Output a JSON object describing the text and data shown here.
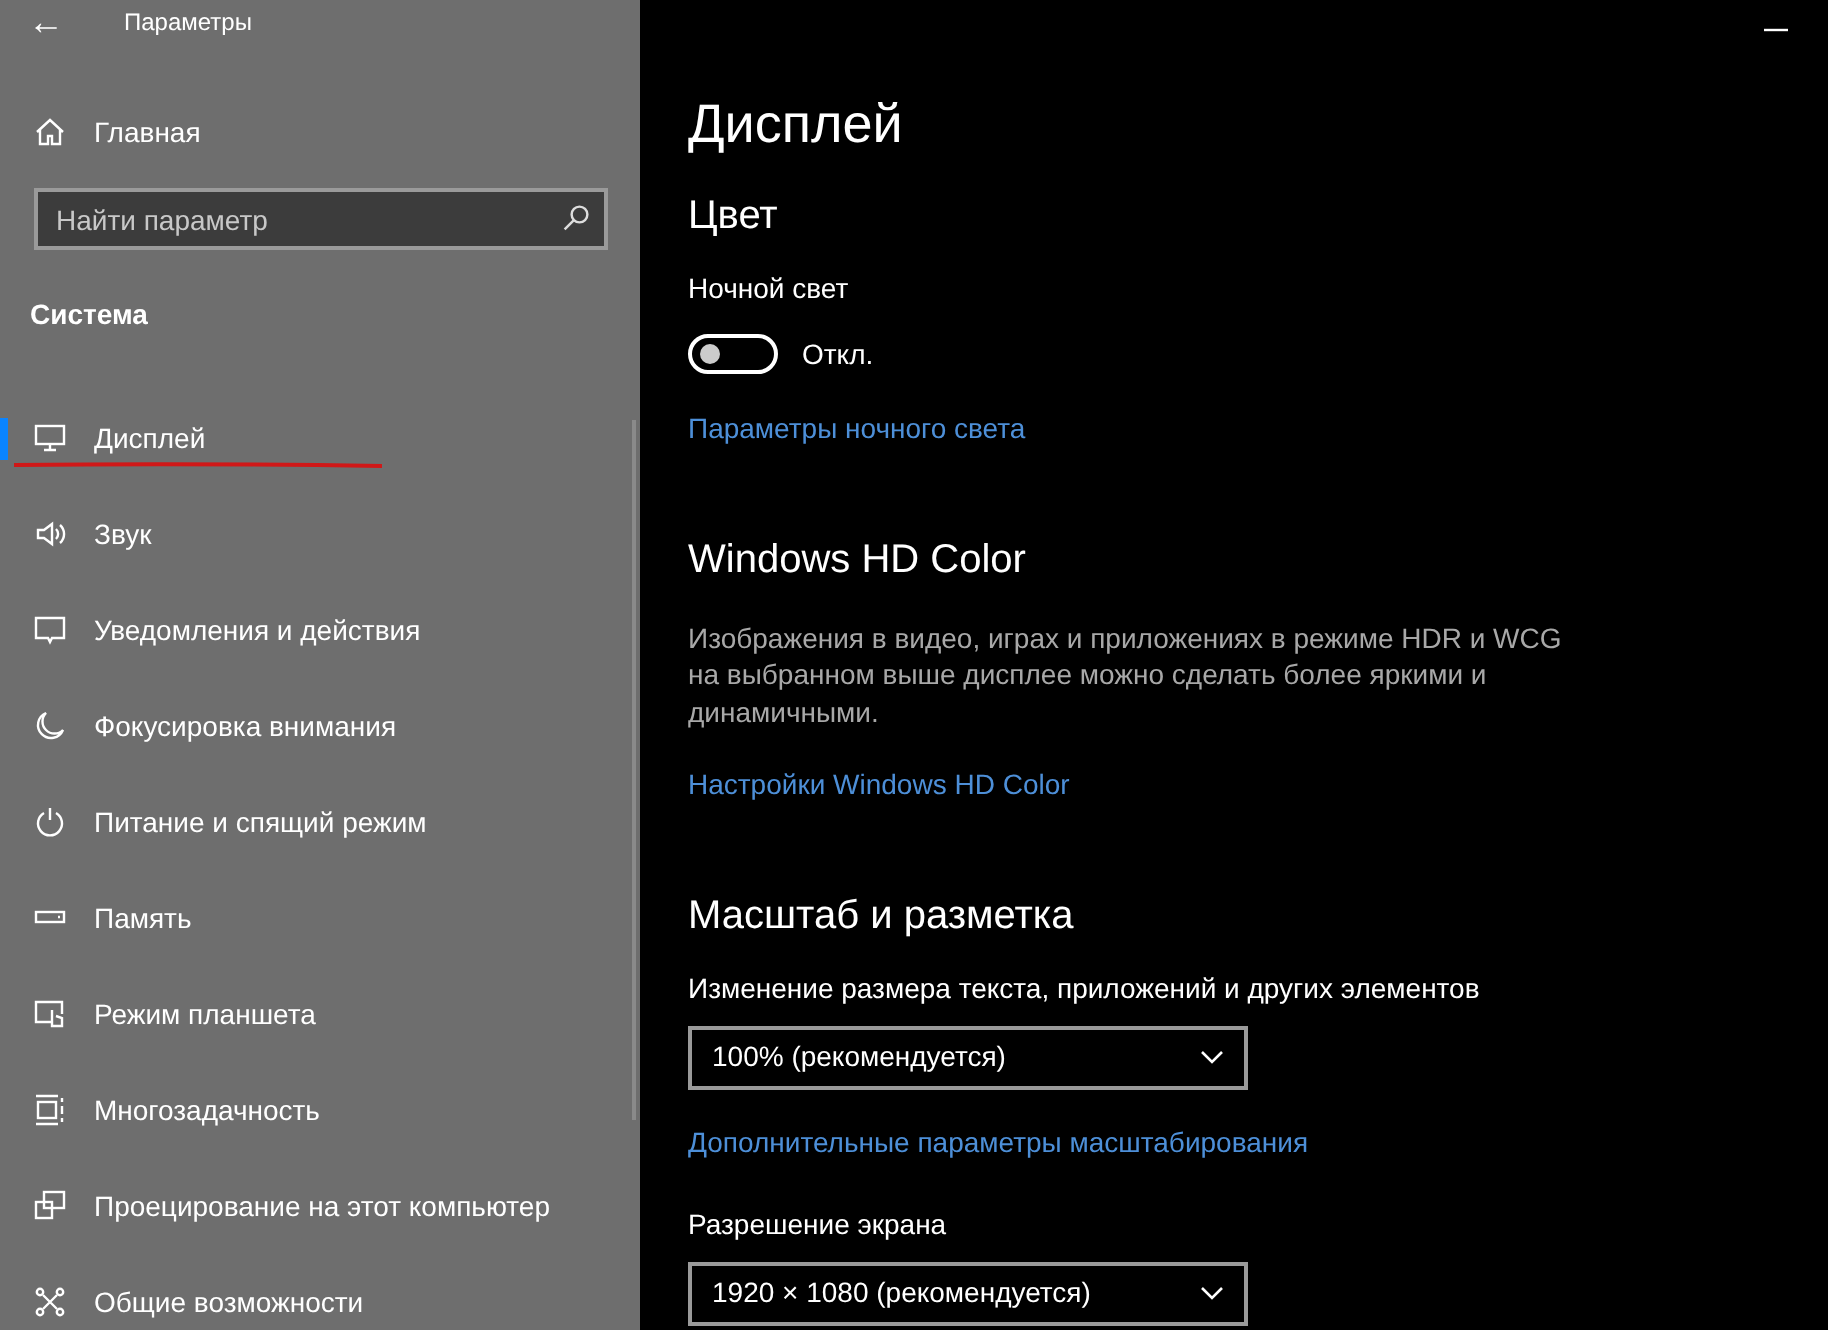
{
  "window": {
    "title": "Параметры",
    "back": "←"
  },
  "sidebar": {
    "home": "Главная",
    "search": {
      "placeholder": "Найти параметр"
    },
    "section": "Система",
    "items": [
      {
        "label": "Дисплей",
        "selected": true,
        "underlined": true
      },
      {
        "label": "Звук",
        "selected": false,
        "underlined": false
      },
      {
        "label": "Уведомления и действия",
        "selected": false,
        "underlined": false
      },
      {
        "label": "Фокусировка внимания",
        "selected": false,
        "underlined": false
      },
      {
        "label": "Питание и спящий режим",
        "selected": false,
        "underlined": false
      },
      {
        "label": "Память",
        "selected": false,
        "underlined": false
      },
      {
        "label": "Режим планшета",
        "selected": false,
        "underlined": false
      },
      {
        "label": "Многозадачность",
        "selected": false,
        "underlined": false
      },
      {
        "label": "Проецирование на этот компьютер",
        "selected": false,
        "underlined": false
      },
      {
        "label": "Общие возможности",
        "selected": false,
        "underlined": false
      }
    ]
  },
  "main": {
    "title": "Дисплей",
    "blocks": [
      {
        "kind": "heading",
        "text": "Цвет"
      },
      {
        "kind": "label",
        "text": "Ночной свет"
      },
      {
        "kind": "toggle",
        "on": false,
        "text": "Откл."
      },
      {
        "kind": "link",
        "text": "Параметры ночного света"
      },
      {
        "kind": "heading",
        "text": "Windows HD Color"
      },
      {
        "kind": "paragraph",
        "text": "Изображения в видео, играх и приложениях в режиме HDR и WCG на выбранном выше дисплее можно сделать более яркими и динамичными."
      },
      {
        "kind": "link",
        "text": "Настройки Windows HD Color"
      },
      {
        "kind": "heading",
        "text": "Масштаб и разметка"
      },
      {
        "kind": "label",
        "text": "Изменение размера текста, приложений и других элементов"
      },
      {
        "kind": "dropdown",
        "value": "100% (рекомендуется)"
      },
      {
        "kind": "link",
        "text": "Дополнительные параметры масштабирования"
      },
      {
        "kind": "label",
        "text": "Разрешение экрана"
      },
      {
        "kind": "dropdown",
        "value": "1920 × 1080 (рекомендуется)"
      }
    ]
  }
}
